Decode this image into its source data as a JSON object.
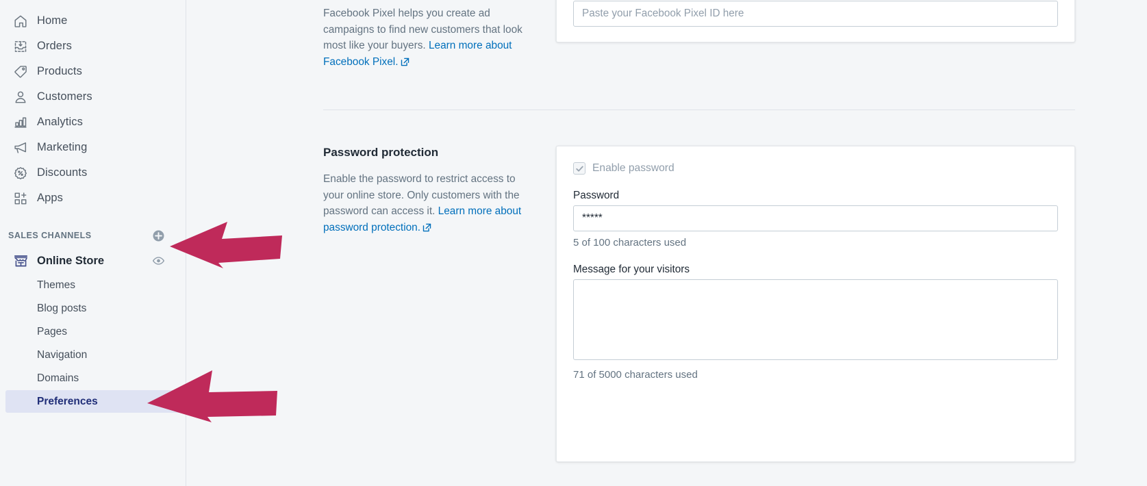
{
  "sidebar": {
    "nav_items": [
      {
        "label": "Home",
        "icon": "home-icon"
      },
      {
        "label": "Orders",
        "icon": "orders-inbox-icon"
      },
      {
        "label": "Products",
        "icon": "products-tag-icon"
      },
      {
        "label": "Customers",
        "icon": "customers-person-icon"
      },
      {
        "label": "Analytics",
        "icon": "analytics-bar-chart-icon"
      },
      {
        "label": "Marketing",
        "icon": "marketing-megaphone-icon"
      },
      {
        "label": "Discounts",
        "icon": "discounts-percent-icon"
      },
      {
        "label": "Apps",
        "icon": "apps-grid-plus-icon"
      }
    ],
    "section_title": "SALES CHANNELS",
    "add_channel_icon": "plus-circle-icon",
    "store": {
      "label": "Online Store",
      "icon": "online-store-icon",
      "preview_icon": "eye-icon"
    },
    "sub_items": [
      {
        "label": "Themes",
        "active": false
      },
      {
        "label": "Blog posts",
        "active": false
      },
      {
        "label": "Pages",
        "active": false
      },
      {
        "label": "Navigation",
        "active": false
      },
      {
        "label": "Domains",
        "active": false
      },
      {
        "label": "Preferences",
        "active": true
      }
    ]
  },
  "facebook_pixel": {
    "description_part1": "Facebook Pixel helps you create ad campaigns to find new customers that look most like your buyers. ",
    "link_text": "Learn more about Facebook Pixel.",
    "external_icon": "external-link-icon",
    "input_placeholder": "Paste your Facebook Pixel ID here",
    "input_value": ""
  },
  "password_protection": {
    "title": "Password protection",
    "description_part1": "Enable the password to restrict access to your online store. Only customers with the password can access it. ",
    "link_text": "Learn more about password protection.",
    "external_icon": "external-link-icon",
    "checkbox_label": "Enable password",
    "checkbox_checked": true,
    "checkbox_icon": "checkmark-icon",
    "password_label": "Password",
    "password_value": "*****",
    "password_helper": "5 of 100 characters used",
    "message_label": "Message for your visitors",
    "message_value": "",
    "message_helper": "71 of 5000 characters used"
  },
  "annotations": {
    "arrow_color": "#bf2a5a",
    "arrows": [
      {
        "name": "arrow-pointing-to-add-sales-channel"
      },
      {
        "name": "arrow-pointing-to-preferences"
      }
    ]
  }
}
